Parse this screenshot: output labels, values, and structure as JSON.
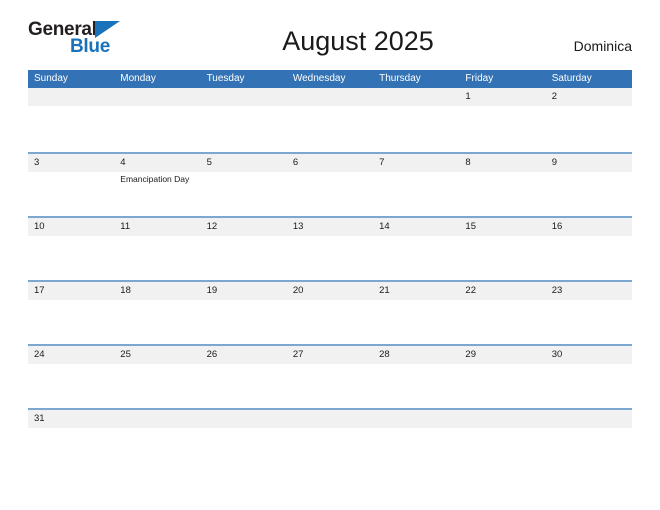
{
  "branding": {
    "logo_text_primary": "General",
    "logo_text_secondary": "Blue",
    "logo_triangle_color": "#1a72bb"
  },
  "header": {
    "title": "August 2025",
    "country": "Dominica"
  },
  "theme": {
    "header_blue": "#3372b5",
    "row_divider_blue": "#7ba7d0",
    "date_band_gray": "#f1f1f1",
    "text_color": "#1a1a1a"
  },
  "calendar": {
    "weekdays": [
      "Sunday",
      "Monday",
      "Tuesday",
      "Wednesday",
      "Thursday",
      "Friday",
      "Saturday"
    ],
    "weeks": [
      [
        {
          "date": "",
          "events": []
        },
        {
          "date": "",
          "events": []
        },
        {
          "date": "",
          "events": []
        },
        {
          "date": "",
          "events": []
        },
        {
          "date": "",
          "events": []
        },
        {
          "date": "1",
          "events": []
        },
        {
          "date": "2",
          "events": []
        }
      ],
      [
        {
          "date": "3",
          "events": []
        },
        {
          "date": "4",
          "events": [
            "Emancipation Day"
          ]
        },
        {
          "date": "5",
          "events": []
        },
        {
          "date": "6",
          "events": []
        },
        {
          "date": "7",
          "events": []
        },
        {
          "date": "8",
          "events": []
        },
        {
          "date": "9",
          "events": []
        }
      ],
      [
        {
          "date": "10",
          "events": []
        },
        {
          "date": "11",
          "events": []
        },
        {
          "date": "12",
          "events": []
        },
        {
          "date": "13",
          "events": []
        },
        {
          "date": "14",
          "events": []
        },
        {
          "date": "15",
          "events": []
        },
        {
          "date": "16",
          "events": []
        }
      ],
      [
        {
          "date": "17",
          "events": []
        },
        {
          "date": "18",
          "events": []
        },
        {
          "date": "19",
          "events": []
        },
        {
          "date": "20",
          "events": []
        },
        {
          "date": "21",
          "events": []
        },
        {
          "date": "22",
          "events": []
        },
        {
          "date": "23",
          "events": []
        }
      ],
      [
        {
          "date": "24",
          "events": []
        },
        {
          "date": "25",
          "events": []
        },
        {
          "date": "26",
          "events": []
        },
        {
          "date": "27",
          "events": []
        },
        {
          "date": "28",
          "events": []
        },
        {
          "date": "29",
          "events": []
        },
        {
          "date": "30",
          "events": []
        }
      ],
      [
        {
          "date": "31",
          "events": []
        },
        {
          "date": "",
          "events": []
        },
        {
          "date": "",
          "events": []
        },
        {
          "date": "",
          "events": []
        },
        {
          "date": "",
          "events": []
        },
        {
          "date": "",
          "events": []
        },
        {
          "date": "",
          "events": []
        }
      ]
    ]
  }
}
